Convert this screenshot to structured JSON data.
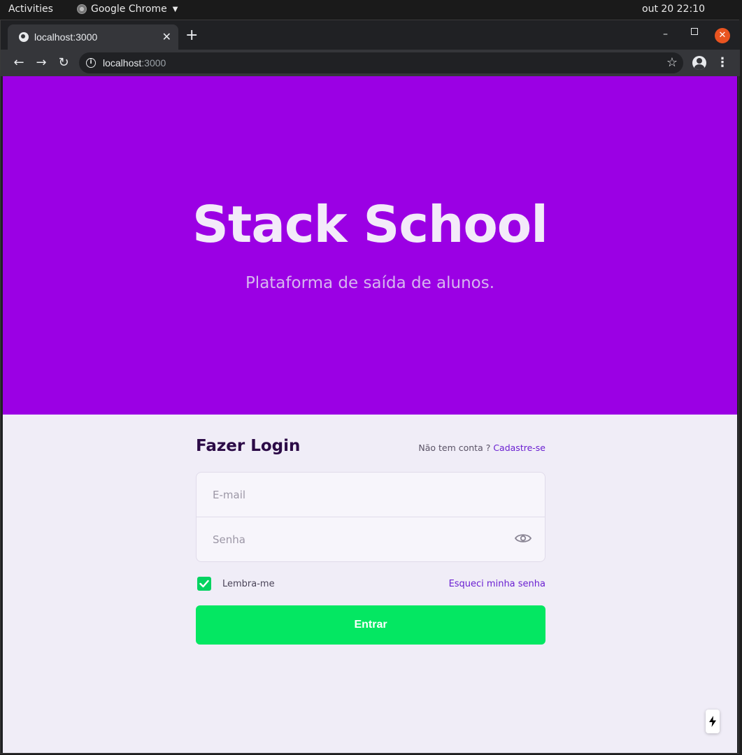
{
  "system_bar": {
    "activities": "Activities",
    "app_name": "Google Chrome",
    "clock": "out 20  22:10"
  },
  "browser": {
    "tab_title": "localhost:3000",
    "url_host": "localhost",
    "url_port": ":3000"
  },
  "hero": {
    "title": "Stack School",
    "subtitle": "Plataforma de saída de alunos."
  },
  "login": {
    "heading": "Fazer Login",
    "no_account_text": "Não tem conta ? ",
    "signup_link": "Cadastre-se",
    "email_placeholder": "E-mail",
    "password_placeholder": "Senha",
    "remember_label": "Lembra-me",
    "remember_checked": true,
    "forgot_link": "Esqueci minha senha",
    "submit_label": "Entrar"
  },
  "colors": {
    "hero_bg": "#9b00e4",
    "page_bg": "#f0edf7",
    "accent_green": "#04e762",
    "link_purple": "#6a1fd1",
    "heading_dark": "#2c0b47"
  }
}
